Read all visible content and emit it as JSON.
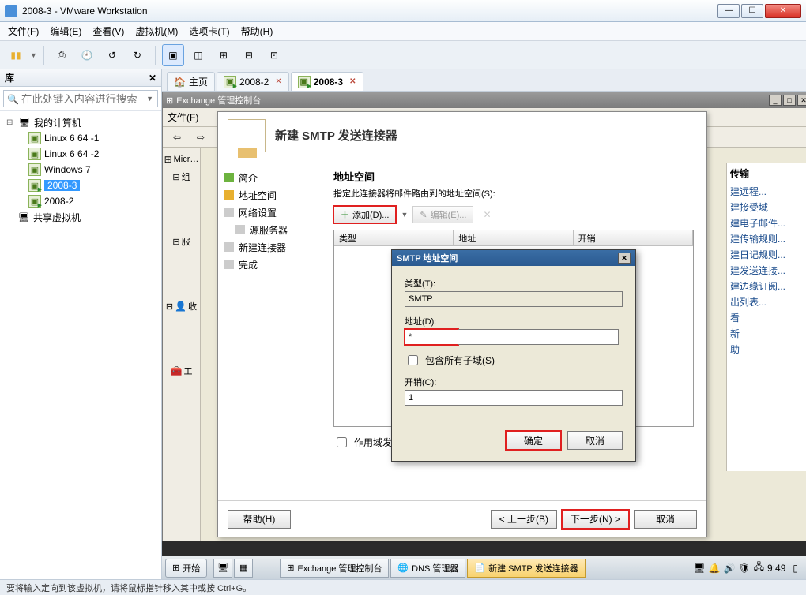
{
  "window": {
    "title": "2008-3 - VMware Workstation"
  },
  "menubar": [
    "文件(F)",
    "编辑(E)",
    "查看(V)",
    "虚拟机(M)",
    "选项卡(T)",
    "帮助(H)"
  ],
  "library": {
    "title": "库",
    "search_placeholder": "在此处键入内容进行搜索",
    "root": "我的计算机",
    "items": [
      "Linux 6 64 -1",
      "Linux 6 64 -2",
      "Windows 7",
      "2008-3",
      "2008-2"
    ],
    "selected": "2008-3",
    "shared": "共享虚拟机"
  },
  "tabs": [
    {
      "label": "主页",
      "home": true
    },
    {
      "label": "2008-2"
    },
    {
      "label": "2008-3",
      "active": true
    }
  ],
  "exchange": {
    "title": "Exchange 管理控制台",
    "menu": "文件(F)",
    "nav": [
      "Micr…",
      "组",
      "服",
      "收",
      "工"
    ],
    "actions_header": "传输",
    "actions": [
      "建远程...",
      "建接受域",
      "建电子邮件...",
      "建传输规则...",
      "建日记规则...",
      "建发送连接...",
      "建边缘订阅...",
      "出列表...",
      "看",
      "新",
      "助"
    ]
  },
  "wizard": {
    "title": "新建 SMTP 发送连接器",
    "steps": [
      {
        "label": "简介",
        "state": "g"
      },
      {
        "label": "地址空间",
        "state": "y"
      },
      {
        "label": "网络设置",
        "state": "gr"
      },
      {
        "label": "源服务器",
        "state": "gr",
        "indent": true
      },
      {
        "label": "新建连接器",
        "state": "gr"
      },
      {
        "label": "完成",
        "state": "gr"
      }
    ],
    "section_title": "地址空间",
    "section_desc": "指定此连接器将邮件路由到的地址空间(S):",
    "toolbar": {
      "add": "添加(D)...",
      "edit": "编辑(E)..."
    },
    "table_headers": [
      "类型",
      "地址",
      "开销"
    ],
    "scoped_checkbox": "作用域发送连接器(O)",
    "buttons": {
      "help": "帮助(H)",
      "back": "< 上一步(B)",
      "next": "下一步(N) >",
      "cancel": "取消"
    }
  },
  "smtp_dialog": {
    "title": "SMTP 地址空间",
    "type_label": "类型(T):",
    "type_value": "SMTP",
    "address_label": "地址(D):",
    "address_value": "*",
    "subdomain_label": "包含所有子域(S)",
    "cost_label": "开销(C):",
    "cost_value": "1",
    "ok": "确定",
    "cancel": "取消"
  },
  "guest_taskbar": {
    "start": "开始",
    "items": [
      "Exchange 管理控制台",
      "DNS 管理器",
      "新建 SMTP 发送连接器"
    ],
    "active_index": 2,
    "time": "9:49"
  },
  "statusbar": "要将输入定向到该虚拟机，请将鼠标指针移入其中或按 Ctrl+G。"
}
